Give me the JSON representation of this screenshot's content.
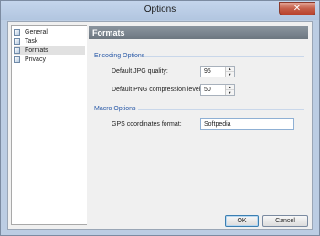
{
  "window": {
    "title": "Options",
    "close_glyph": "✕"
  },
  "nav": {
    "items": [
      {
        "label": "General",
        "selected": false
      },
      {
        "label": "Task",
        "selected": false
      },
      {
        "label": "Formats",
        "selected": true
      },
      {
        "label": "Privacy",
        "selected": false
      }
    ]
  },
  "panel": {
    "header": "Formats",
    "encoding": {
      "title": "Encoding Options",
      "jpg_label": "Default JPG quality:",
      "jpg_value": "95",
      "png_label": "Default PNG compression level:",
      "png_value": "50"
    },
    "macro": {
      "title": "Macro Options",
      "gps_label": "GPS coordinates format:",
      "gps_value": "Softpedia"
    }
  },
  "buttons": {
    "ok": "OK",
    "cancel": "Cancel"
  },
  "spin_glyphs": {
    "up": "▲",
    "down": "▼"
  }
}
